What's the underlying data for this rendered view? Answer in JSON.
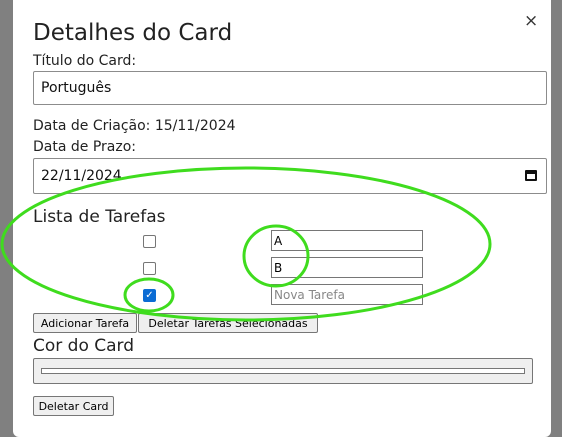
{
  "modal": {
    "title": "Detalhes do Card",
    "close_label": "×",
    "card_title_label": "Título do Card:",
    "card_title_value": "Português",
    "creation_date_text": "Data de Criação: 15/11/2024",
    "due_date_label": "Data de Prazo:",
    "due_date_value": "22/11/2024",
    "tasks_heading": "Lista de Tarefas",
    "tasks": [
      {
        "text": "A",
        "checked": false
      },
      {
        "text": "B",
        "checked": false
      }
    ],
    "new_task": {
      "placeholder": "Nova Tarefa",
      "checked": true
    },
    "add_task_button": "Adicionar Tarefa",
    "delete_selected_button": "Deletar Tarefas Selecionadas",
    "card_color_heading": "Cor do Card",
    "card_color_value": "#ffffff",
    "delete_card_button": "Deletar Card"
  },
  "colors": {
    "overlay": "#808080",
    "annotation": "#3fdc1e",
    "checkbox_checked": "#0b6cd4"
  }
}
